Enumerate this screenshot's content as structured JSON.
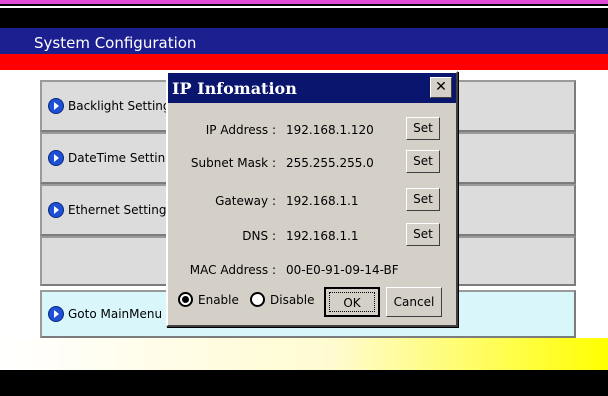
{
  "window": {
    "title": "System Configuration"
  },
  "menu": {
    "items": [
      {
        "label": "Backlight Setting"
      },
      {
        "label": "DateTime Setting"
      },
      {
        "label": "Ethernet Setting"
      },
      {
        "label": ""
      },
      {
        "label": "Goto MainMenu"
      }
    ]
  },
  "dialog": {
    "title": "IP Infomation",
    "close_label": "✕",
    "fields": [
      {
        "label": "IP Address :",
        "value": "192.168.1.120",
        "button": "Set"
      },
      {
        "label": "Subnet Mask :",
        "value": "255.255.255.0",
        "button": "Set"
      },
      {
        "label": "Gateway :",
        "value": "192.168.1.1",
        "button": "Set"
      },
      {
        "label": "DNS :",
        "value": "192.168.1.1",
        "button": "Set"
      }
    ],
    "mac": {
      "label": "MAC Address :",
      "value": "00-E0-91-09-14-BF"
    },
    "radios": [
      {
        "label": "Enable",
        "selected": true
      },
      {
        "label": "Disable",
        "selected": false
      }
    ],
    "ok_label": "OK",
    "cancel_label": "Cancel"
  },
  "colors": {
    "title_bar": "#1c1f8f",
    "red_strip": "#ff0000",
    "dialog_title": "#0a166e",
    "accent_pink": "#e24bd8",
    "bottom_yellow": "#ffff00"
  }
}
